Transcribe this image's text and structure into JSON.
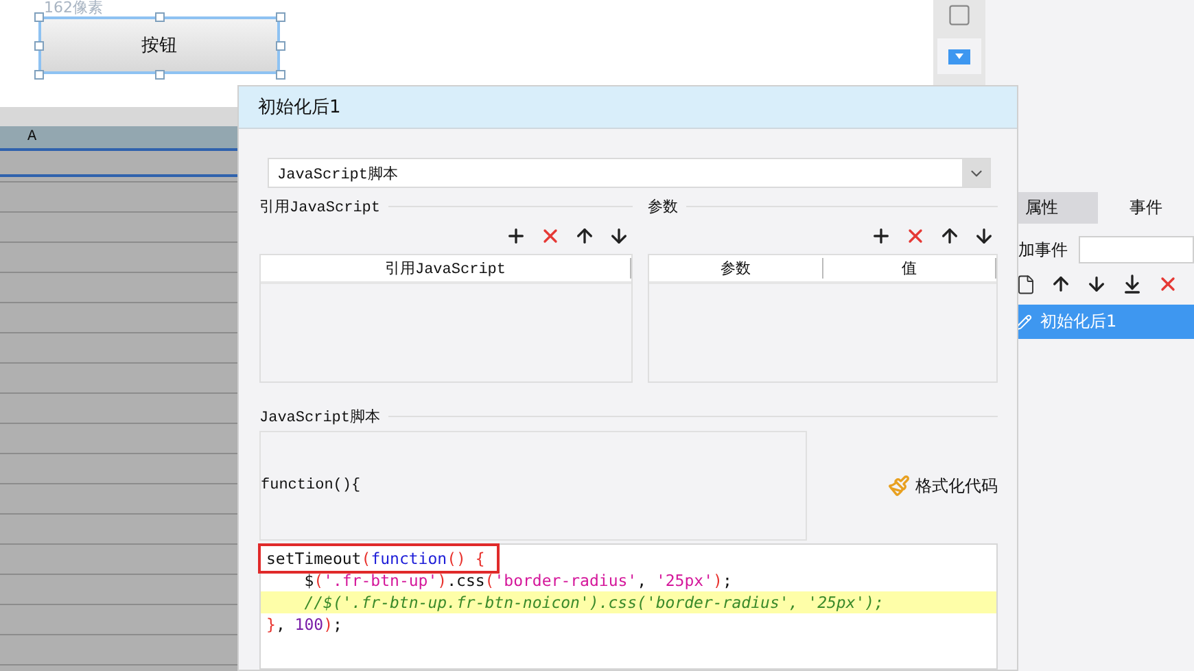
{
  "canvas": {
    "size_label": "162像素",
    "widget_button": "按钮"
  },
  "sheet": {
    "column_header": "A"
  },
  "side_panel": {
    "tabs": [
      {
        "label": "属性",
        "selected": false
      },
      {
        "label": "事件",
        "selected": true
      }
    ],
    "add_event_label": "加事件",
    "events": [
      {
        "label": "初始化后1",
        "selected": true
      }
    ]
  },
  "dialog": {
    "title": "初始化后1",
    "type_select": {
      "value": "JavaScript脚本"
    },
    "imports_section": {
      "title": "引用JavaScript",
      "columns": [
        "引用JavaScript"
      ]
    },
    "params_section": {
      "title": "参数",
      "columns": [
        "参数",
        "值"
      ]
    },
    "script_section": {
      "title": "JavaScript脚本",
      "header": "function(){",
      "format_button": "格式化代码",
      "lines": [
        {
          "highlighted": false,
          "boxed": true,
          "tokens": [
            {
              "kind": "plain",
              "text": "setTimeout"
            },
            {
              "kind": "punct",
              "text": "("
            },
            {
              "kind": "keyword",
              "text": "function"
            },
            {
              "kind": "punct",
              "text": "() {"
            }
          ]
        },
        {
          "highlighted": false,
          "boxed": false,
          "tokens": [
            {
              "kind": "plain",
              "text": "    $"
            },
            {
              "kind": "punct",
              "text": "("
            },
            {
              "kind": "string",
              "text": "'.fr-btn-up'"
            },
            {
              "kind": "punct",
              "text": ")"
            },
            {
              "kind": "plain",
              "text": ".css"
            },
            {
              "kind": "punct",
              "text": "("
            },
            {
              "kind": "string",
              "text": "'border-radius'"
            },
            {
              "kind": "plain",
              "text": ", "
            },
            {
              "kind": "string",
              "text": "'25px'"
            },
            {
              "kind": "punct",
              "text": ")"
            },
            {
              "kind": "plain",
              "text": ";"
            }
          ]
        },
        {
          "highlighted": true,
          "boxed": false,
          "tokens": [
            {
              "kind": "comment",
              "text": "    //$('.fr-btn-up.fr-btn-noicon').css('border-radius', '25px');"
            }
          ]
        },
        {
          "highlighted": false,
          "boxed": false,
          "tokens": [
            {
              "kind": "punct",
              "text": "}"
            },
            {
              "kind": "plain",
              "text": ", "
            },
            {
              "kind": "number",
              "text": "100"
            },
            {
              "kind": "punct",
              "text": ")"
            },
            {
              "kind": "plain",
              "text": ";"
            }
          ]
        }
      ]
    }
  }
}
